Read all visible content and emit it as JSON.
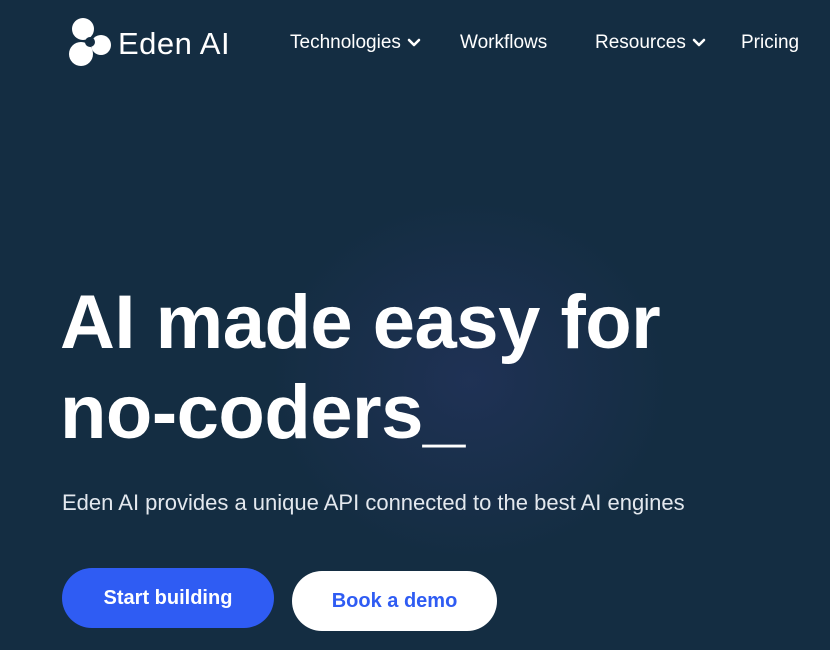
{
  "brand": {
    "name": "Eden AI"
  },
  "nav": {
    "items": [
      {
        "label": "Technologies",
        "has_dropdown": true
      },
      {
        "label": "Workflows",
        "has_dropdown": false
      },
      {
        "label": "Resources",
        "has_dropdown": true
      },
      {
        "label": "Pricing",
        "has_dropdown": false
      }
    ]
  },
  "hero": {
    "title_line1": "AI made easy for",
    "title_line2": "no-coders_",
    "subtitle": "Eden AI provides a unique API connected to the best AI engines",
    "primary_cta": "Start building",
    "secondary_cta": "Book a demo"
  },
  "colors": {
    "background": "#142d42",
    "accent": "#2f5cf3",
    "text": "#ffffff"
  }
}
